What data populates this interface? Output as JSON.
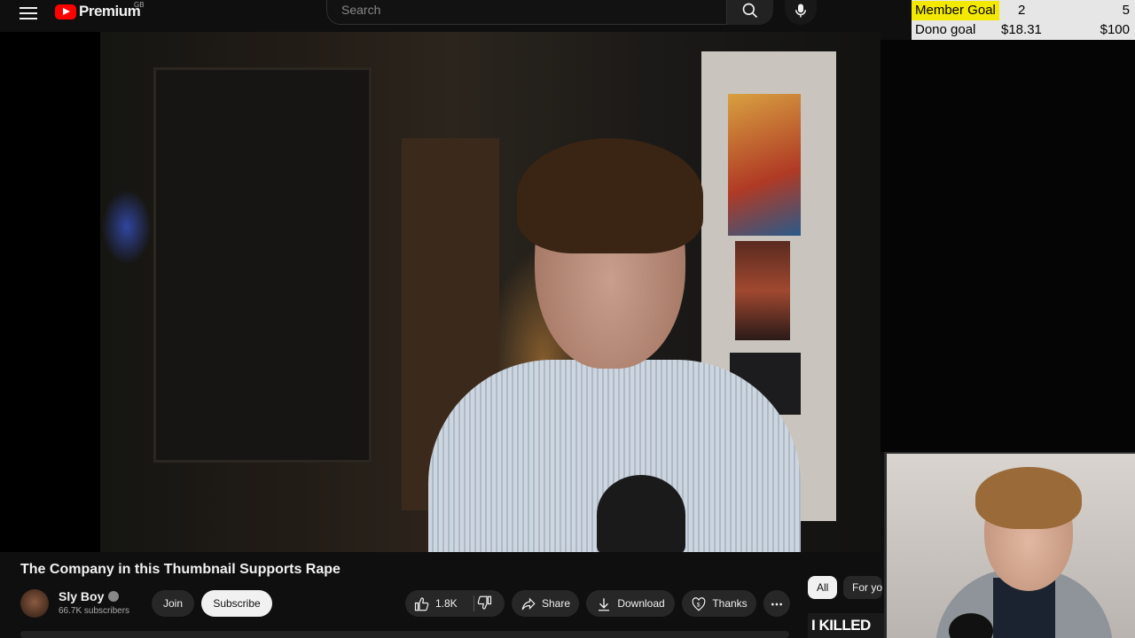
{
  "header": {
    "logo_text": "Premium",
    "region": "GB",
    "search_placeholder": "Search"
  },
  "overlay_goals": [
    {
      "label": "Member Goal",
      "current": "2",
      "target": "5"
    },
    {
      "label": "Dono goal",
      "current": "$18.31",
      "target": "$100"
    }
  ],
  "video": {
    "title": "The Company in this Thumbnail Supports Rape",
    "channel": "Sly Boy",
    "subscribers": "66.7K subscribers",
    "join_label": "Join",
    "subscribe_label": "Subscribe",
    "likes": "1.8K",
    "share_label": "Share",
    "download_label": "Download",
    "thanks_label": "Thanks"
  },
  "filters": [
    "All",
    "For you"
  ],
  "suggested_thumb_text": "I KILLED",
  "colors": {
    "accent": "#ff0000",
    "goal_highlight": "#f3e900"
  }
}
